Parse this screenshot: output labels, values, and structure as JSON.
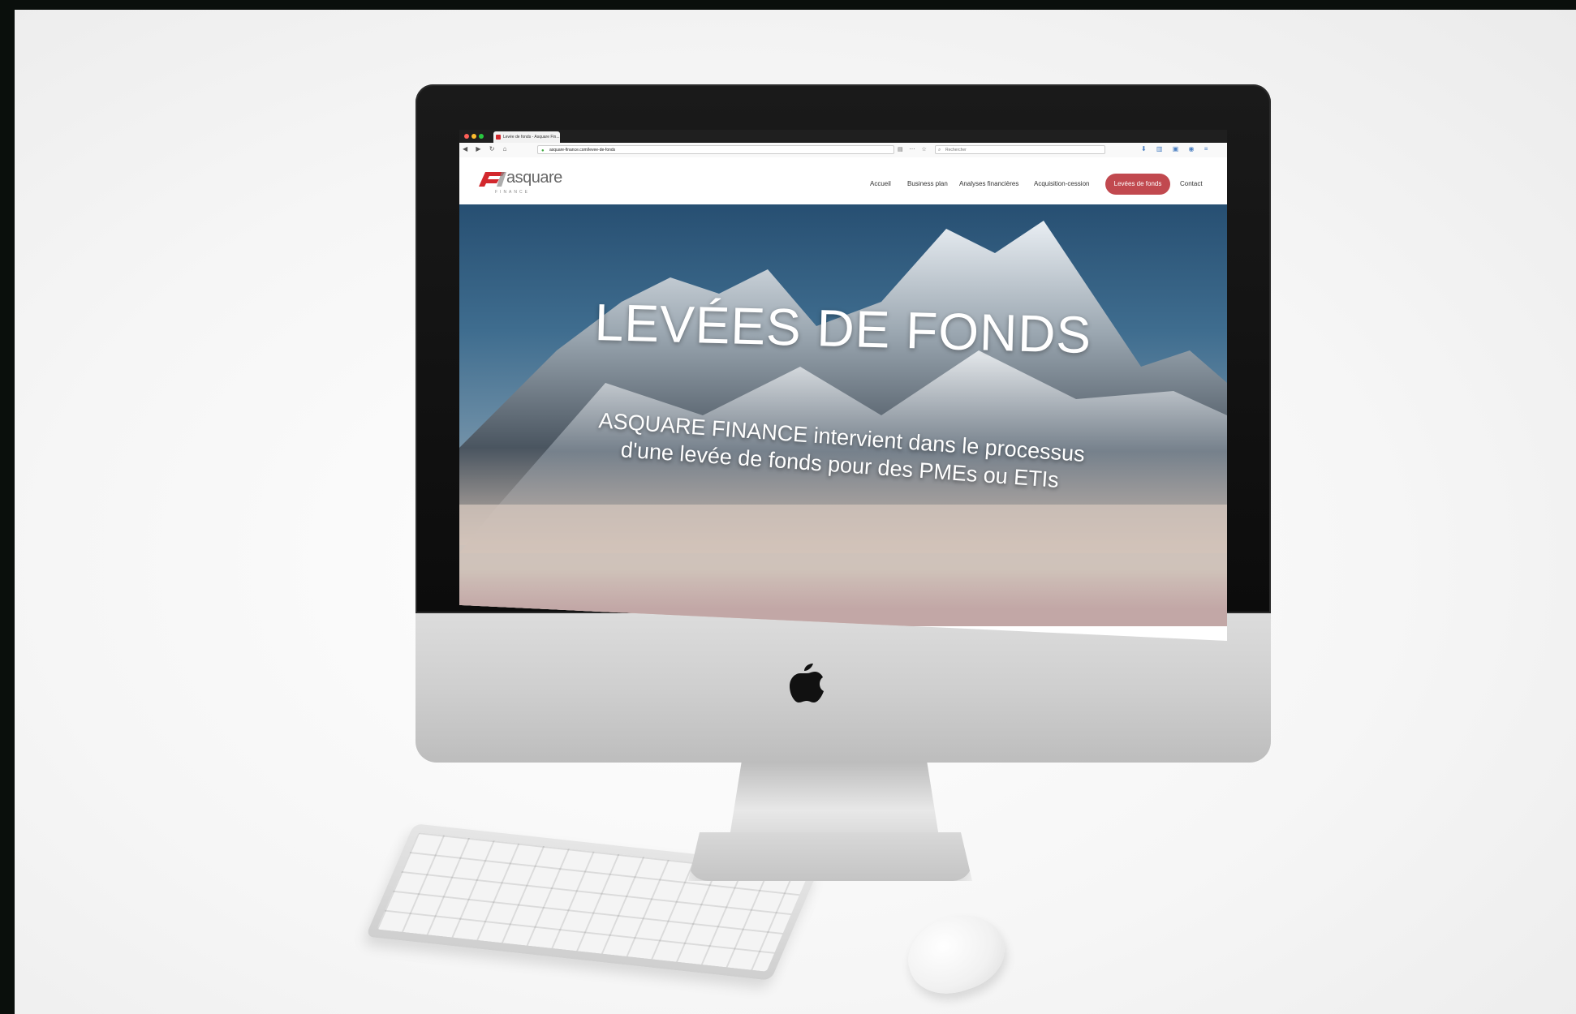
{
  "browser": {
    "tab_title": "Levée de fonds - Asquare Fin...",
    "url": "asquare-finance.com/levee-de-fonds",
    "search_placeholder": "Rechercher"
  },
  "site": {
    "logo_text": "asquare",
    "logo_sub": "FINANCE",
    "nav": [
      {
        "label": "Accueil"
      },
      {
        "label": "Business plan"
      },
      {
        "label": "Analyses financières"
      },
      {
        "label": "Acquisition-cession"
      },
      {
        "label": "Levées de fonds",
        "active": true
      },
      {
        "label": "Contact"
      }
    ]
  },
  "hero": {
    "title": "LEVÉES DE FONDS",
    "subtitle_line1": "ASQUARE FINANCE intervient dans le processus",
    "subtitle_line2": "d'une levée de fonds pour des PMEs ou ETIs"
  },
  "colors": {
    "accent": "#c1494f",
    "logo_red": "#d2282d"
  },
  "icons": [
    "apple-logo-icon",
    "lock-icon",
    "search-icon",
    "back-icon",
    "forward-icon",
    "reload-icon",
    "home-icon"
  ]
}
